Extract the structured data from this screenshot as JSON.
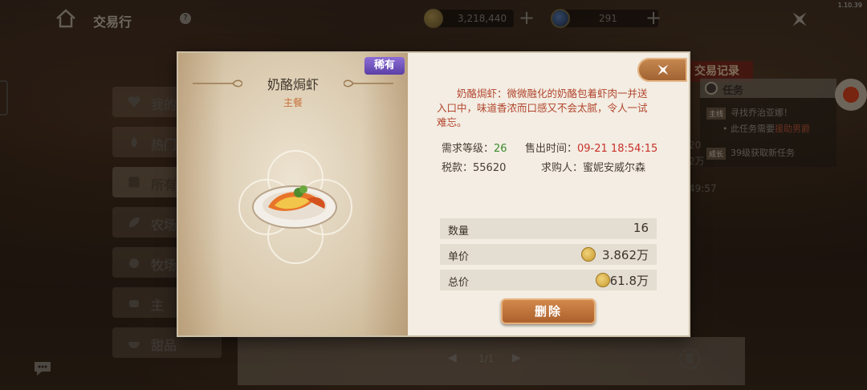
{
  "version": "1.10.39",
  "topbar": {
    "title": "交易行",
    "help": "?",
    "gold": "3,218,440",
    "gems": "291",
    "plus": "+"
  },
  "left_nav": [
    {
      "label": "我的",
      "active": false
    },
    {
      "label": "热门",
      "active": false
    },
    {
      "label": "所有",
      "active": true
    },
    {
      "label": "农场",
      "active": false
    },
    {
      "label": "牧场",
      "active": false
    },
    {
      "label": "主",
      "active": false
    },
    {
      "label": "甜品",
      "active": false
    }
  ],
  "right_panel": {
    "record_tab": "交易记录",
    "task_title": "任务",
    "main_tag": "主线",
    "main_task": "寻找乔治亚娜！",
    "main_sub_prefix": "此任务需要",
    "main_sub_hl": "援助男爵",
    "growth_tag": "成长",
    "growth_text": "39级获取新任务",
    "partial_1": "20",
    "partial_2": "2万",
    "partial_3": "49:57"
  },
  "pager": {
    "text": "1/1"
  },
  "dialog": {
    "rarity": "稀有",
    "item_name": "奶酪焗虾",
    "category": "主餐",
    "description": "奶酪焗虾：微微融化的奶酪包着虾肉一并送入口中，味道香浓而口感又不会太腻，令人一试难忘。",
    "level_label": "需求等级：",
    "level_value": "26",
    "sell_time_label": "售出时间：",
    "sell_time_value": "09-21 18:54:15",
    "tax_label": "税款：",
    "tax_value": "55620",
    "buyer_label": "求购人：",
    "buyer_value": "蜜妮安威尔森",
    "qty_label": "数量",
    "qty_value": "16",
    "unit_label": "单价",
    "unit_value": "3.862万",
    "total_label": "总价",
    "total_value": "61.8万",
    "delete_label": "删除"
  },
  "colors": {
    "rarity_bg": "#6e4fc0",
    "desc_text": "#b2452d",
    "level_green": "#3a8a2e",
    "time_red": "#c8322a",
    "button_orange": "#c27a42"
  }
}
